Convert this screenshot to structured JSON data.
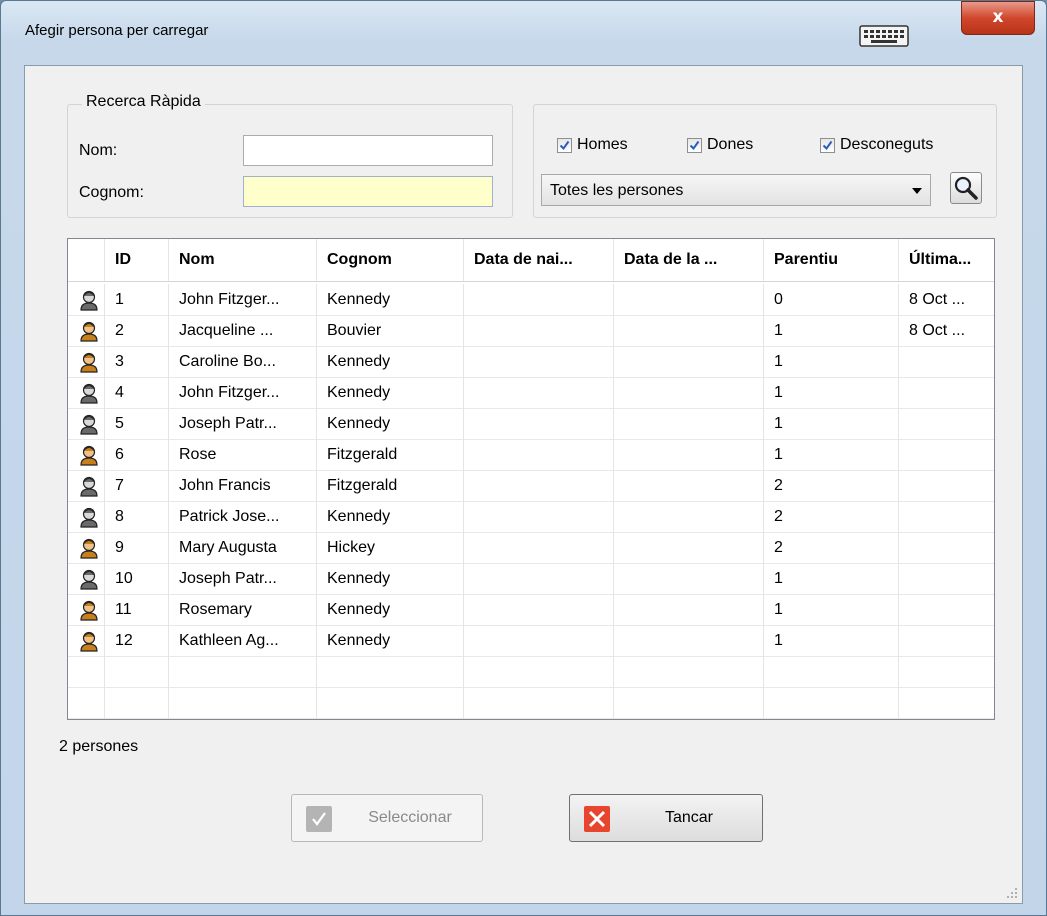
{
  "window": {
    "title": "Afegir persona per carregar",
    "close_label": "x"
  },
  "quick_search": {
    "legend": "Recerca Ràpida",
    "name_label": "Nom:",
    "name_value": "",
    "surname_label": "Cognom:",
    "surname_value": ""
  },
  "filters": {
    "men_label": "Homes",
    "men_checked": true,
    "women_label": "Dones",
    "women_checked": true,
    "unknown_label": "Desconeguts",
    "unknown_checked": true,
    "people_select": "Totes les persones"
  },
  "table": {
    "columns": [
      "ID",
      "Nom",
      "Cognom",
      "Data de nai...",
      "Data de la ...",
      "Parentiu",
      "Última..."
    ],
    "rows": [
      {
        "id": "1",
        "nom": "John Fitzger...",
        "cognom": "Kennedy",
        "naix": "",
        "mort": "",
        "parentiu": "0",
        "ultima": "8 Oct ...",
        "icon": "male-icon"
      },
      {
        "id": "2",
        "nom": "Jacqueline ...",
        "cognom": "Bouvier",
        "naix": "",
        "mort": "",
        "parentiu": "1",
        "ultima": "8 Oct ...",
        "icon": "female-icon"
      },
      {
        "id": "3",
        "nom": "Caroline Bo...",
        "cognom": "Kennedy",
        "naix": "",
        "mort": "",
        "parentiu": "1",
        "ultima": "",
        "icon": "female-icon"
      },
      {
        "id": "4",
        "nom": "John Fitzger...",
        "cognom": "Kennedy",
        "naix": "",
        "mort": "",
        "parentiu": "1",
        "ultima": "",
        "icon": "male-icon"
      },
      {
        "id": "5",
        "nom": "Joseph Patr...",
        "cognom": "Kennedy",
        "naix": "",
        "mort": "",
        "parentiu": "1",
        "ultima": "",
        "icon": "male-icon"
      },
      {
        "id": "6",
        "nom": "Rose",
        "cognom": "Fitzgerald",
        "naix": "",
        "mort": "",
        "parentiu": "1",
        "ultima": "",
        "icon": "female-icon"
      },
      {
        "id": "7",
        "nom": "John Francis",
        "cognom": "Fitzgerald",
        "naix": "",
        "mort": "",
        "parentiu": "2",
        "ultima": "",
        "icon": "male-icon"
      },
      {
        "id": "8",
        "nom": "Patrick Jose...",
        "cognom": "Kennedy",
        "naix": "",
        "mort": "",
        "parentiu": "2",
        "ultima": "",
        "icon": "male-icon"
      },
      {
        "id": "9",
        "nom": "Mary Augusta",
        "cognom": "Hickey",
        "naix": "",
        "mort": "",
        "parentiu": "2",
        "ultima": "",
        "icon": "female-icon"
      },
      {
        "id": "10",
        "nom": "Joseph Patr...",
        "cognom": "Kennedy",
        "naix": "",
        "mort": "",
        "parentiu": "1",
        "ultima": "",
        "icon": "male-icon"
      },
      {
        "id": "11",
        "nom": "Rosemary",
        "cognom": "Kennedy",
        "naix": "",
        "mort": "",
        "parentiu": "1",
        "ultima": "",
        "icon": "female-icon"
      },
      {
        "id": "12",
        "nom": "Kathleen Ag...",
        "cognom": "Kennedy",
        "naix": "",
        "mort": "",
        "parentiu": "1",
        "ultima": "",
        "icon": "female-icon"
      }
    ]
  },
  "status": {
    "count_text": "2 persones"
  },
  "buttons": {
    "select_label": "Seleccionar",
    "close_label": "Tancar"
  },
  "colors": {
    "highlight_input": "#ffffcc",
    "close_red": "#d1472c",
    "male_icon": "#6a6a6a",
    "female_icon": "#c8801c"
  }
}
